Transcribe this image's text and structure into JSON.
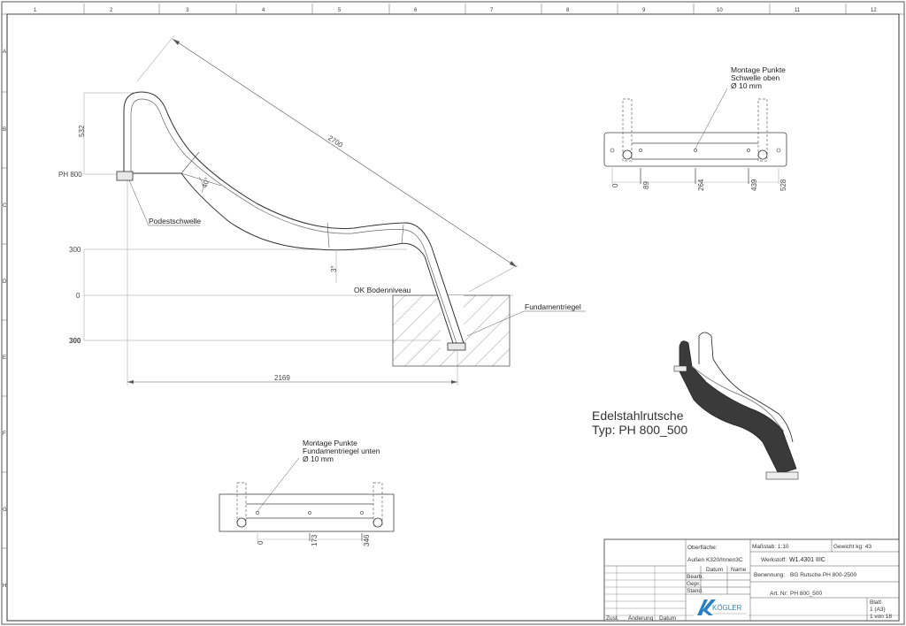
{
  "border": {
    "columns": [
      "1",
      "2",
      "3",
      "4",
      "5",
      "6",
      "7",
      "8",
      "9",
      "10",
      "11",
      "12"
    ],
    "rows": [
      "A",
      "B",
      "C",
      "D",
      "E",
      "F",
      "G",
      "H"
    ]
  },
  "side_view": {
    "dim_2700": "2700",
    "dim_532": "532",
    "level_ph800": "PH 800",
    "level_300": "300",
    "level_0": "0",
    "level_300_below": "300",
    "angle_40": "40°",
    "angle_3": "3°",
    "dim_2169": "2169",
    "label_podestschwelle": "Podestschwelle",
    "label_ok_bodenniveau": "OK Bodenniveau",
    "label_fundamentriegel": "Fundamentriegel"
  },
  "top_view_upper": {
    "note_line1": "Montage Punkte",
    "note_line2": "Schwelle oben",
    "note_line3": "Ø 10 mm",
    "dims": [
      "0",
      "89",
      "264",
      "439",
      "528"
    ]
  },
  "top_view_lower": {
    "note_line1": "Montage Punkte",
    "note_line2": "Fundamentriegel unten",
    "note_line3": "Ø 10 mm",
    "dims": [
      "0",
      "173",
      "346"
    ]
  },
  "iso_view": {
    "title_line1": "Edelstahlrutsche",
    "title_line2": "Typ: PH 800_500"
  },
  "title_block": {
    "oberflaeche_label": "Oberfläche:",
    "oberflaeche_value": "Außen K320/Innen3C",
    "massstab": "Maßstab: 1:10",
    "gewicht": "Gewicht kg: 43",
    "werkstoff_label": "Werkstoff:",
    "werkstoff_value": "W1.4301 IIIC",
    "benennung_label": "Benennung:",
    "benennung_value": "BG Rutsche PH 800-2500",
    "datum": "Datum",
    "name": "Name",
    "bearb": "Bearb.",
    "gepr": "Gepr.",
    "stand": "Stand.",
    "artnr_label": "Art. Nr:",
    "artnr_value": "PH 800_500",
    "blatt": "Blatt",
    "blatt_a3": "1 (A3)",
    "blatt_von": "1 von 18",
    "zust": "Zust.",
    "aenderung": "Änderung",
    "datum2": "Datum",
    "logo_text": "KÖGLER"
  }
}
